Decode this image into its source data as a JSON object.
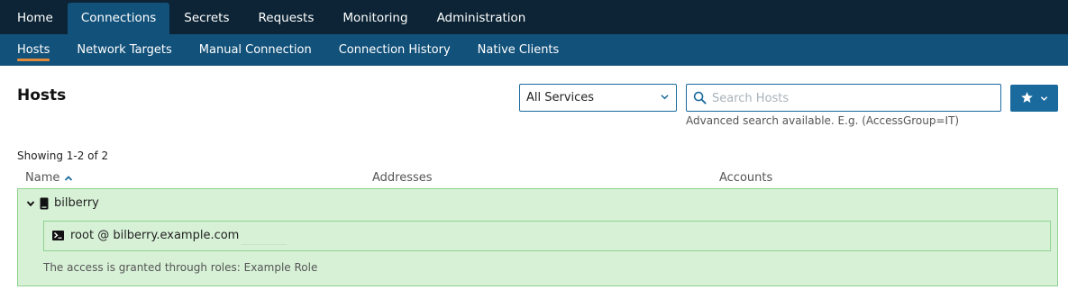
{
  "top_nav": [
    {
      "label": "Home",
      "active": false
    },
    {
      "label": "Connections",
      "active": true
    },
    {
      "label": "Secrets",
      "active": false
    },
    {
      "label": "Requests",
      "active": false
    },
    {
      "label": "Monitoring",
      "active": false
    },
    {
      "label": "Administration",
      "active": false
    }
  ],
  "sub_nav": [
    {
      "label": "Hosts",
      "active": true
    },
    {
      "label": "Network Targets",
      "active": false
    },
    {
      "label": "Manual Connection",
      "active": false
    },
    {
      "label": "Connection History",
      "active": false
    },
    {
      "label": "Native Clients",
      "active": false
    }
  ],
  "page": {
    "title": "Hosts",
    "service_filter": {
      "selected": "All Services"
    },
    "search": {
      "placeholder": "Search Hosts",
      "value": "",
      "hint": "Advanced search available. E.g. (AccessGroup=IT)"
    },
    "favorites_button": {
      "icon": "star-icon"
    },
    "showing": "Showing 1-2 of 2"
  },
  "table": {
    "columns": [
      "Name",
      "Addresses",
      "Accounts"
    ],
    "sort": {
      "column": "Name",
      "direction": "ascending"
    },
    "hosts": [
      {
        "name": "bilberry",
        "icon": "server-icon",
        "expanded": true,
        "accounts": [
          {
            "label": "root @ bilberry.example.com",
            "icon": "terminal-icon"
          }
        ],
        "roles_note": "The access is granted through roles: Example Role"
      }
    ]
  },
  "colors": {
    "top_bar": "#0c2435",
    "sub_bar": "#12517a",
    "active_underline": "#e08a3a",
    "accent": "#1a6a9e",
    "host_bg": "#d7f1d7",
    "host_border": "#8fd28f"
  }
}
